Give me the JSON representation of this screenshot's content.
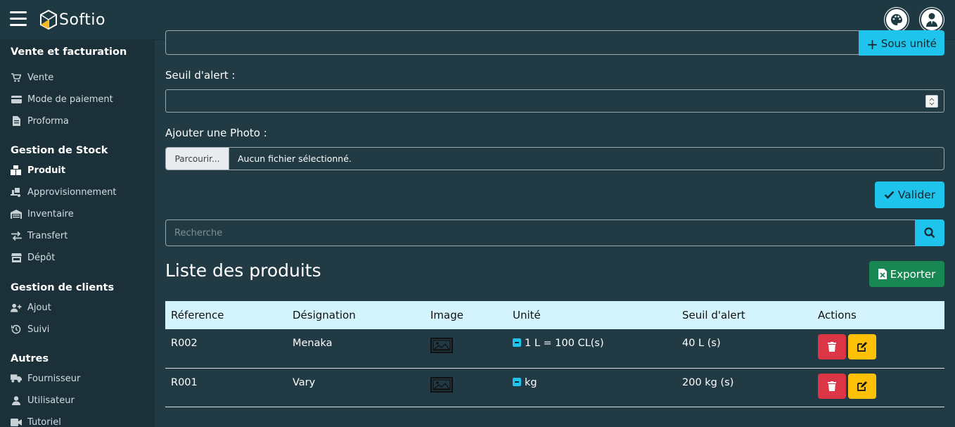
{
  "header": {
    "brand": "Softio",
    "menu_icon": "hamburger-icon",
    "theme_icon": "palette-icon",
    "profile_icon": "user-tie-icon"
  },
  "sidebar": {
    "groups": [
      {
        "title": "Vente et facturation",
        "items": [
          {
            "label": "Vente",
            "icon": "cart-icon"
          },
          {
            "label": "Mode de paiement",
            "icon": "credit-card-icon"
          },
          {
            "label": "Proforma",
            "icon": "document-icon"
          }
        ]
      },
      {
        "title": "Gestion de Stock",
        "items": [
          {
            "label": "Produit",
            "icon": "boxes-icon",
            "active": true
          },
          {
            "label": "Approvisionnement",
            "icon": "truck-loading-icon"
          },
          {
            "label": "Inventaire",
            "icon": "warehouse-icon"
          },
          {
            "label": "Transfert",
            "icon": "exchange-icon"
          },
          {
            "label": "Dépôt",
            "icon": "store-icon"
          }
        ]
      },
      {
        "title": "Gestion de clients",
        "items": [
          {
            "label": "Ajout",
            "icon": "user-plus-icon"
          },
          {
            "label": "Suivi",
            "icon": "history-icon"
          }
        ]
      },
      {
        "title": "Autres",
        "items": [
          {
            "label": "Fournisseur",
            "icon": "truck-icon"
          },
          {
            "label": "Utilisateur",
            "icon": "user-icon"
          },
          {
            "label": "Tutoriel",
            "icon": "video-icon"
          }
        ]
      }
    ]
  },
  "form": {
    "sous_unite_button": "Sous unité",
    "seuil_label": "Seuil d'alert :",
    "seuil_value": "",
    "photo_label": "Ajouter une Photo :",
    "browse_button": "Parcourir...",
    "file_status": "Aucun fichier sélectionné.",
    "validate_button": "Valider"
  },
  "search": {
    "placeholder": "Recherche"
  },
  "list": {
    "title": "Liste des produits",
    "export_button": "Exporter",
    "columns": [
      "Réference",
      "Désignation",
      "Image",
      "Unité",
      "Seuil d'alert",
      "Actions"
    ],
    "rows": [
      {
        "reference": "R002",
        "designation": "Menaka",
        "unit": "1 L = 100 CL(s)",
        "threshold": "40 L (s)"
      },
      {
        "reference": "R001",
        "designation": "Vary",
        "unit": "kg",
        "threshold": "200 kg (s)"
      }
    ]
  },
  "colors": {
    "accent": "#1ec4ec",
    "danger": "#dc3545",
    "warning": "#ffc107",
    "success": "#198754",
    "sidebar_bg": "#1b3038",
    "content_bg": "#213a44"
  }
}
